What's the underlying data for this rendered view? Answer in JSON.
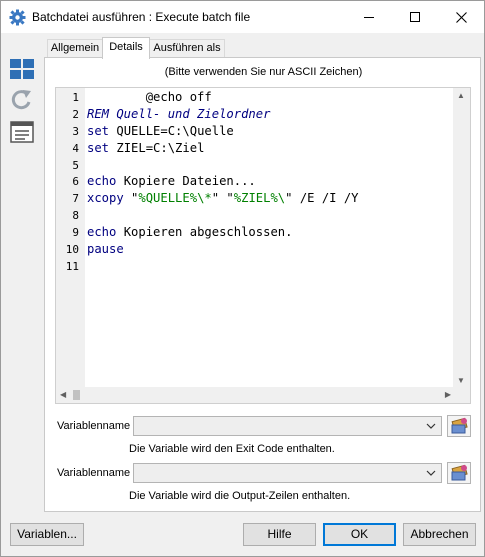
{
  "window": {
    "title": "Batchdatei ausführen : Execute batch file"
  },
  "tabs": [
    {
      "label": "Allgemein"
    },
    {
      "label": "Details"
    },
    {
      "label": "Ausführen als"
    }
  ],
  "details": {
    "ascii_hint": "(Bitte verwenden Sie nur ASCII Zeichen)",
    "code_lines": [
      {
        "num": "1",
        "text": "        @echo off"
      },
      {
        "num": "2",
        "text": "REM Quell- und Zielordner"
      },
      {
        "num": "3",
        "text": "set QUELLE=C:\\Quelle"
      },
      {
        "num": "4",
        "text": "set ZIEL=C:\\Ziel"
      },
      {
        "num": "5",
        "text": ""
      },
      {
        "num": "6",
        "text": "echo Kopiere Dateien..."
      },
      {
        "num": "7",
        "text": "xcopy \"%QUELLE%\\*\" \"%ZIEL%\\\" /E /I /Y"
      },
      {
        "num": "8",
        "text": ""
      },
      {
        "num": "9",
        "text": "echo Kopieren abgeschlossen."
      },
      {
        "num": "10",
        "text": "pause"
      },
      {
        "num": "11",
        "text": ""
      }
    ],
    "var1": {
      "label": "Variablenname",
      "value": "",
      "hint": "Die Variable wird den Exit Code enthalten."
    },
    "var2": {
      "label": "Variablenname",
      "value": "",
      "hint": "Die Variable wird die Output-Zeilen enthalten."
    }
  },
  "buttons": {
    "variables": "Variablen...",
    "help": "Hilfe",
    "ok": "OK",
    "cancel": "Abbrechen"
  },
  "colors": {
    "keyword": "#000080",
    "string": "#008000",
    "ok_border": "#0078d7"
  }
}
